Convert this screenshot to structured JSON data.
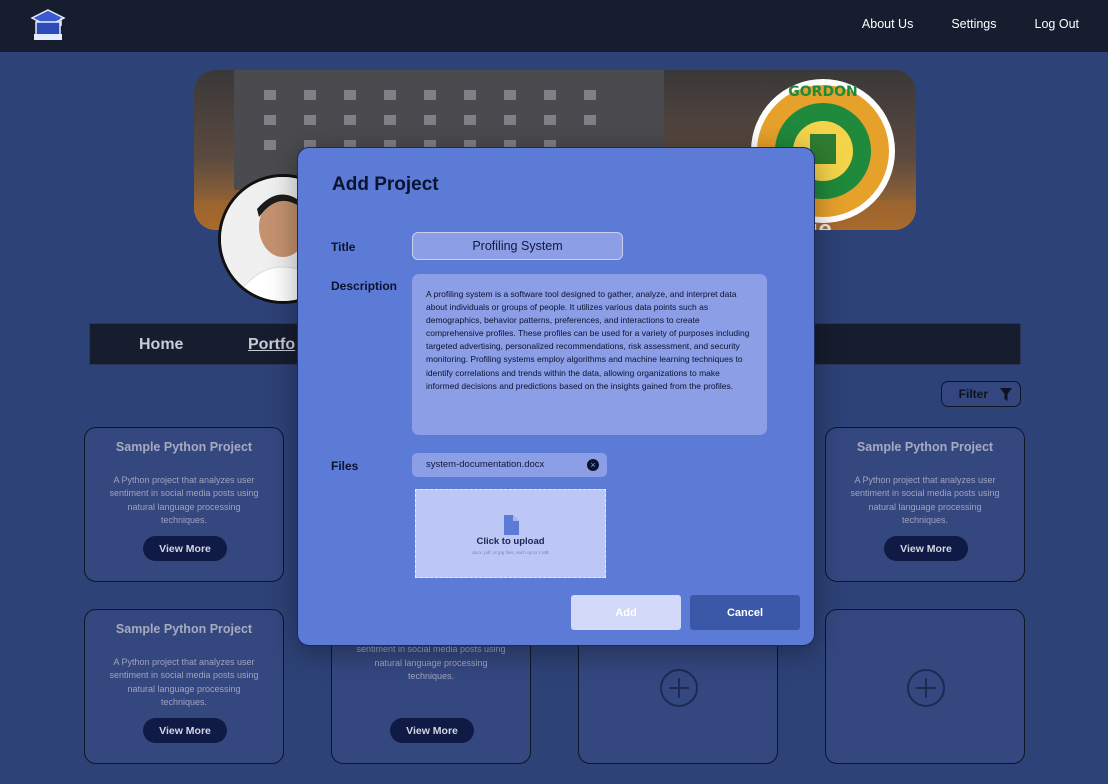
{
  "topbar": {
    "links": [
      "About Us",
      "Settings",
      "Log Out"
    ]
  },
  "banner": {
    "title": "Gordon College"
  },
  "subnav": {
    "home": "Home",
    "portfolio": "Portfo"
  },
  "filter": {
    "label": "Filter"
  },
  "cards": [
    {
      "title": "Sample Python Project",
      "description": "A Python project that analyzes user sentiment in social media posts using natural language processing techniques.",
      "button": "View More"
    },
    {
      "title": "Sample Python Project",
      "description": "A Python project that analyzes user sentiment in social media posts using natural language processing techniques.",
      "button": "View More"
    },
    {
      "title": "Sample Python Project",
      "description": "A Python project that analyzes user sentiment in social media posts using natural language processing techniques.",
      "button": "View More"
    },
    {
      "title": "",
      "description": "A Python project that analyzes user sentiment in social media posts using natural language processing techniques.",
      "button": "View More"
    }
  ],
  "modal": {
    "title": "Add Project",
    "title_label": "Title",
    "title_value": "Profiling System",
    "description_label": "Description",
    "description_value": "A profiling system is a software tool designed to gather, analyze, and interpret data about individuals or groups of people. It utilizes various data points such as demographics, behavior patterns, preferences, and interactions to create comprehensive profiles. These profiles can be used for a variety of purposes including targeted advertising, personalized recommendations, risk assessment, and security monitoring. Profiling systems employ algorithms and machine learning techniques to identify correlations and trends within the data, allowing organizations to make informed decisions and predictions based on the insights gained from the profiles.",
    "files_label": "Files",
    "file_name": "system-documentation.docx",
    "upload_title": "Click to upload",
    "upload_subtitle": "docx, pdf, or jpg files, each up to 1 MB",
    "add_button": "Add",
    "cancel_button": "Cancel"
  },
  "colors": {
    "page_bg": "#2d4277",
    "topbar_bg": "#161d2e",
    "modal_bg": "#5b7bd7",
    "input_bg": "#8b9ee6",
    "cancel_bg": "#3a57a8"
  }
}
